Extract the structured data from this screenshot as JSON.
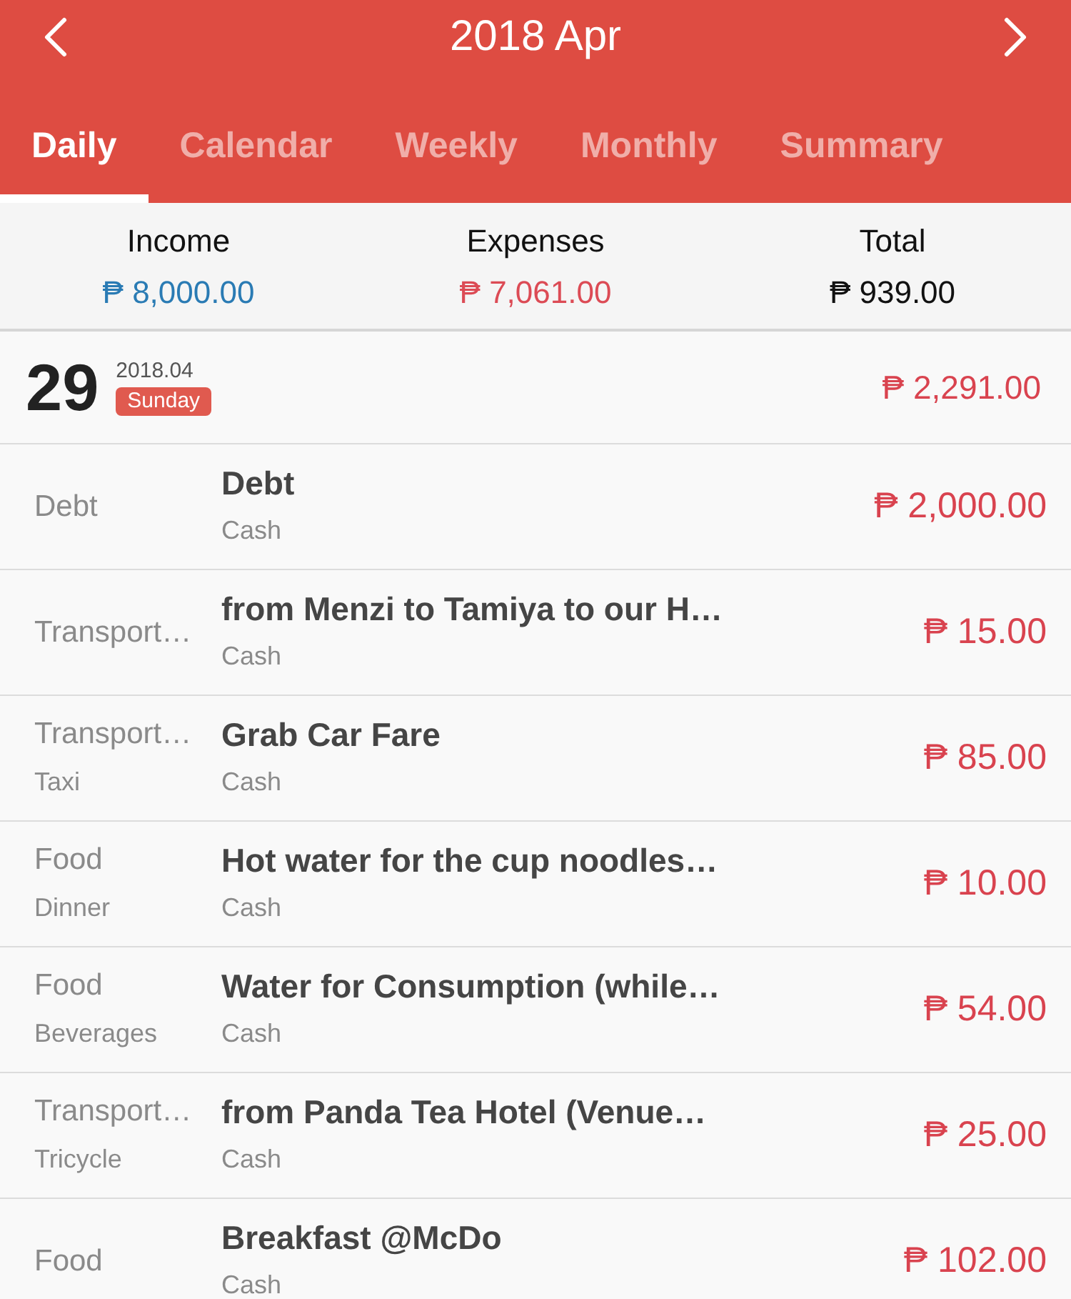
{
  "header": {
    "title": "2018 Apr"
  },
  "tabs": [
    {
      "label": "Daily",
      "selected": true
    },
    {
      "label": "Calendar",
      "selected": false
    },
    {
      "label": "Weekly",
      "selected": false
    },
    {
      "label": "Monthly",
      "selected": false
    },
    {
      "label": "Summary",
      "selected": false
    }
  ],
  "summary": [
    {
      "label": "Income",
      "value": "₱ 8,000.00",
      "kind": "income"
    },
    {
      "label": "Expenses",
      "value": "₱ 7,061.00",
      "kind": "expense"
    },
    {
      "label": "Total",
      "value": "₱ 939.00",
      "kind": "total"
    }
  ],
  "day": {
    "day": "29",
    "month": "2018.04",
    "weekday": "Sunday",
    "total": "₱ 2,291.00"
  },
  "transactions": [
    {
      "category": "Debt",
      "description": "Debt",
      "account": "Cash",
      "amount": "₱ 2,000.00"
    },
    {
      "category": "Transport…",
      "description": "from Menzi to Tamiya to our H…",
      "account": "Cash",
      "amount": "₱ 15.00"
    },
    {
      "category": "Transport…",
      "subcategory": "Taxi",
      "description": "Grab Car Fare",
      "account": "Cash",
      "amount": "₱ 85.00"
    },
    {
      "category": "Food",
      "subcategory": "Dinner",
      "description": "Hot water for the cup noodles…",
      "account": "Cash",
      "amount": "₱ 10.00"
    },
    {
      "category": "Food",
      "subcategory": "Beverages",
      "description": "Water for Consumption (while…",
      "account": "Cash",
      "amount": "₱ 54.00"
    },
    {
      "category": "Transport…",
      "subcategory": "Tricycle",
      "description": "from Panda Tea Hotel (Venue…",
      "account": "Cash",
      "amount": "₱ 25.00"
    },
    {
      "category": "Food",
      "description": "Breakfast @McDo",
      "account": "Cash",
      "amount": "₱ 102.00"
    }
  ]
}
